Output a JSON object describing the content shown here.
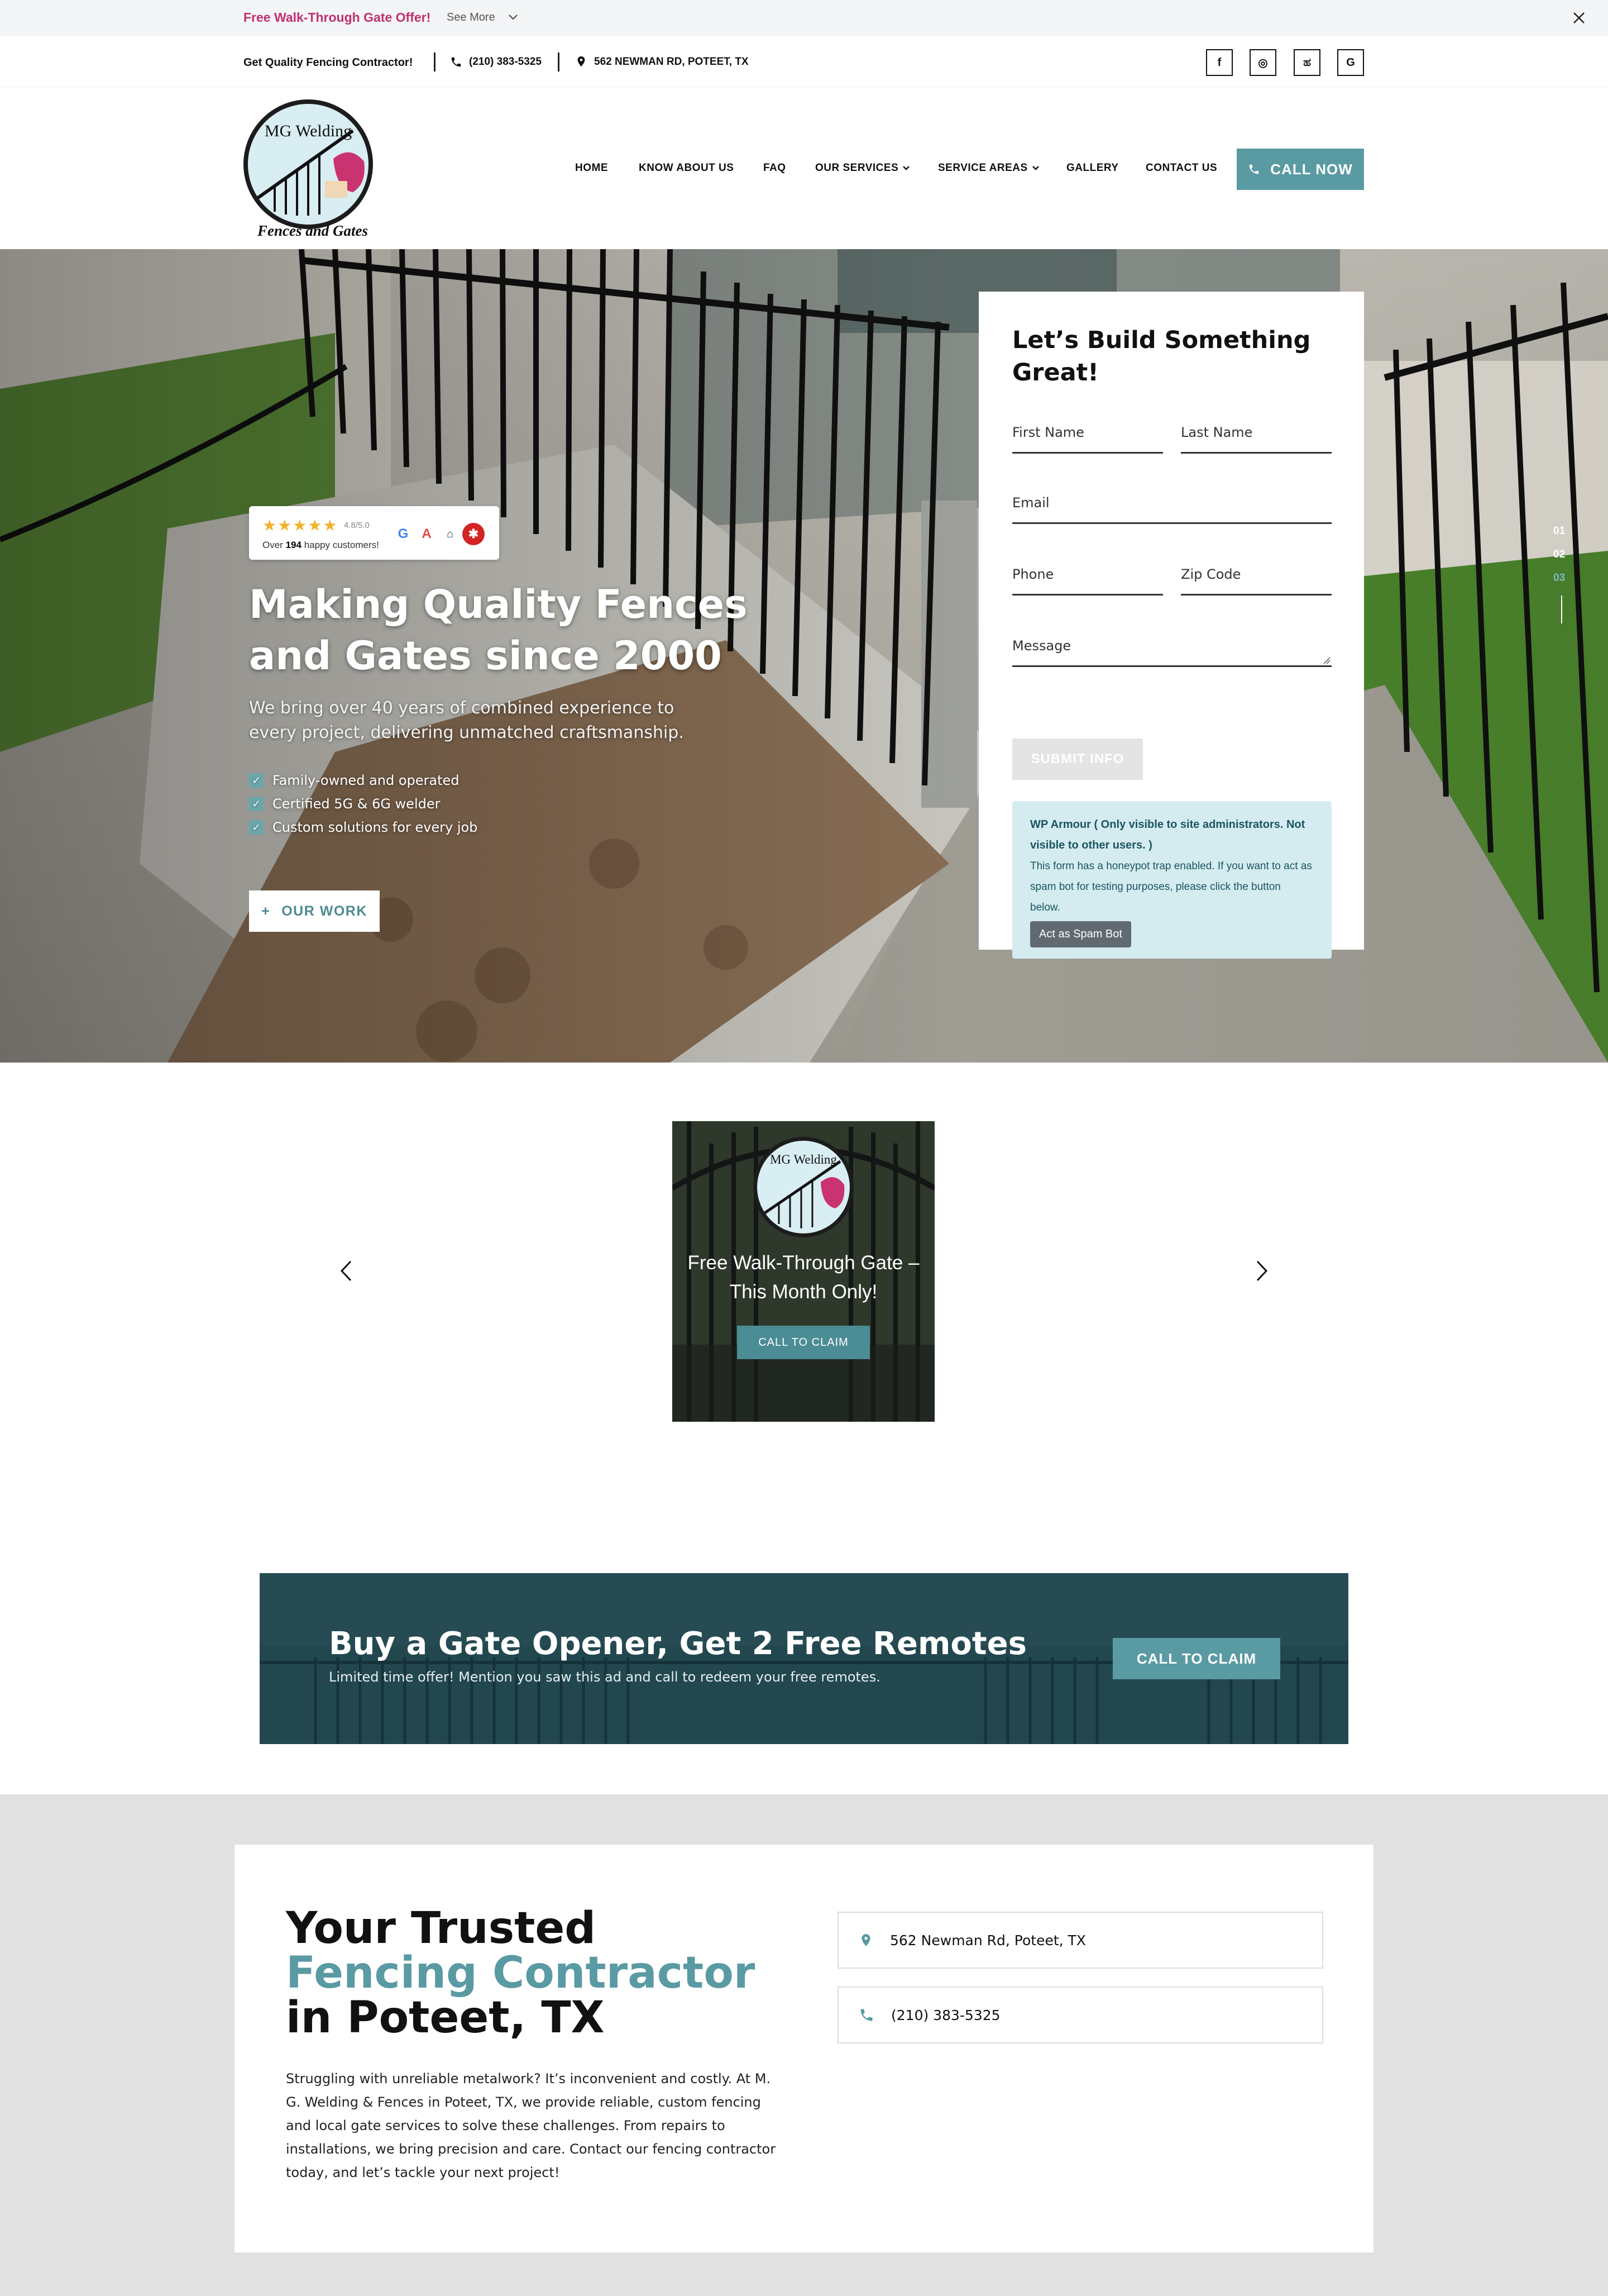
{
  "announcement": {
    "offer": "Free Walk-Through Gate Offer!",
    "see_more": "See More"
  },
  "topbar": {
    "tagline": "Get Quality Fencing Contractor!",
    "phone": "(210) 383-5325",
    "address": "562 NEWMAN RD, POTEET, TX",
    "social": [
      "f",
      "◎",
      "ಹ",
      "G"
    ]
  },
  "nav": {
    "items": [
      "HOME",
      "KNOW ABOUT US",
      "FAQ",
      "OUR SERVICES",
      "SERVICE AREAS",
      "GALLERY",
      "CONTACT US"
    ],
    "cta": "CALL NOW"
  },
  "logo": {
    "line1": "MG Welding",
    "line2": "Fences and Gates"
  },
  "hero": {
    "rating_score": "4.8/5.0",
    "rating_prefix": "Over",
    "rating_count": "194",
    "rating_suffix": "happy customers!",
    "rating_stars": 4.8,
    "title": "Making Quality Fences and Gates since 2000",
    "subtitle": "We bring over 40 years of combined experience to every project, delivering unmatched craftsmanship.",
    "features": [
      "Family-owned and operated",
      "Certified 5G & 6G welder",
      "Custom solutions for every job"
    ],
    "button": "OUR WORK",
    "slides": [
      "01",
      "02",
      "03"
    ],
    "active_slide": 3
  },
  "form": {
    "title": "Let’s Build Something Great!",
    "first_name": "First Name",
    "last_name": "Last Name",
    "email": "Email",
    "phone": "Phone",
    "zip": "Zip Code",
    "message": "Message",
    "submit": "SUBMIT INFO",
    "wp_heading": "WP Armour ( Only visible to site administrators. Not visible to other users. )",
    "wp_text": "This form has a honeypot trap enabled. If you want to act as spam bot for testing purposes, please click the button below.",
    "wp_button": "Act as Spam Bot"
  },
  "promo": {
    "title": "Free Walk-Through Gate – This Month Only!",
    "button": "CALL TO CLAIM"
  },
  "banner": {
    "title": "Buy a Gate Opener, Get 2 Free Remotes",
    "subtitle": "Limited time offer! Mention you saw this ad and call to redeem your free remotes.",
    "button": "CALL TO CLAIM"
  },
  "about": {
    "title_part1": "Your Trusted ",
    "title_accent": "Fencing Contractor",
    "title_part2": " in Poteet, TX",
    "text": "Struggling with unreliable metalwork? It’s inconvenient and costly. At M. G. Welding & Fences in Poteet, TX, we provide reliable, custom fencing and local gate services to solve these challenges. From repairs to installations, we bring precision and care. Contact our fencing contractor today, and let’s tackle your next project!",
    "address": "562 Newman Rd, Poteet, TX",
    "phone": "(210) 383-5325"
  },
  "colors": {
    "accent": "#5a9aa3",
    "offer": "#c0306f",
    "section_bg": "#e1e1e1"
  }
}
